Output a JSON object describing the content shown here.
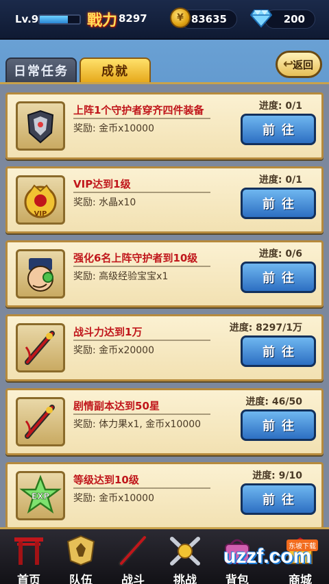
{
  "header": {
    "level": "Lv.9",
    "xp_fraction": 0.7,
    "power_label": "戰力",
    "power": "8297",
    "coins": "83635",
    "gems": "200"
  },
  "tabs": [
    {
      "label": "日常任务",
      "active": false
    },
    {
      "label": "成就",
      "active": true
    }
  ],
  "back_label": "返回",
  "tasks": [
    {
      "title": "上阵1个守护者穿齐四件装备",
      "reward": "奖励: 金币x10000",
      "progress": "进度: 0/1",
      "button": "前往",
      "icon": "armor-icon"
    },
    {
      "title": "VIP达到1级",
      "reward": "奖励: 水晶x10",
      "progress": "进度: 0/1",
      "button": "前往",
      "icon": "vip-badge-icon"
    },
    {
      "title": "强化6名上阵守护者到10级",
      "reward": "奖励: 高级经验宝宝x1",
      "progress": "进度: 0/6",
      "button": "前往",
      "icon": "character-icon"
    },
    {
      "title": "战斗力达到1万",
      "reward": "奖励: 金币x20000",
      "progress": "进度: 8297/1万",
      "button": "前往",
      "icon": "weapon-icon"
    },
    {
      "title": "剧情副本达到50星",
      "reward": "奖励: 体力果x1, 金币x10000",
      "progress": "进度: 46/50",
      "button": "前往",
      "icon": "weapon-icon"
    },
    {
      "title": "等级达到10级",
      "reward": "奖励: 金币x10000",
      "progress": "进度: 9/10",
      "button": "前往",
      "icon": "exp-star-icon"
    }
  ],
  "nav": [
    {
      "label": "首页",
      "icon": "gate-icon"
    },
    {
      "label": "队伍",
      "icon": "team-icon"
    },
    {
      "label": "战斗",
      "icon": "battle-icon"
    },
    {
      "label": "挑战",
      "icon": "challenge-icon"
    },
    {
      "label": "背包",
      "icon": "bag-icon"
    },
    {
      "label": "商城",
      "icon": "shop-icon"
    }
  ],
  "watermark": {
    "text": "uzzf.com",
    "badge": "东坡下载"
  },
  "colors": {
    "title_red": "#c0161b",
    "button_blue": "#2d6fc2",
    "gold": "#c9a24a"
  }
}
